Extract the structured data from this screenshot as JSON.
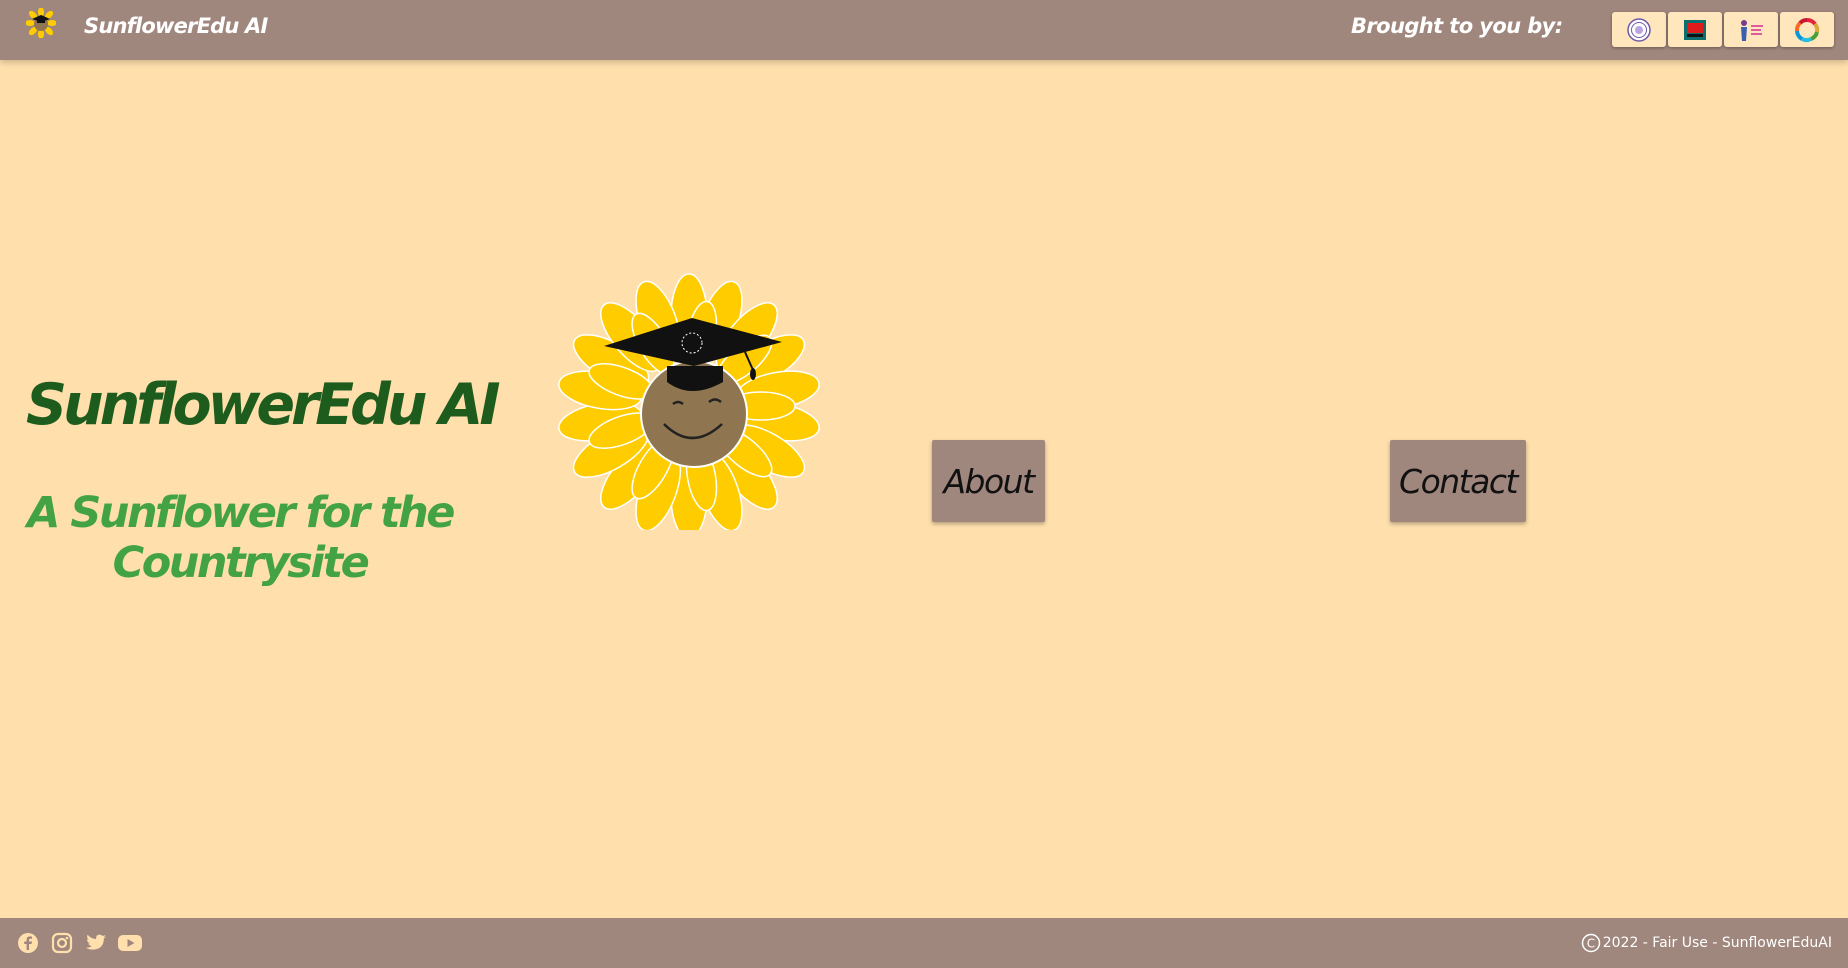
{
  "header": {
    "brand": "SunflowerEdu AI",
    "brought_by": "Brought to you by:",
    "sponsors": [
      {
        "icon": "university-seal-icon"
      },
      {
        "icon": "screen-logo-icon"
      },
      {
        "icon": "women-figure-logo-icon"
      },
      {
        "icon": "sdg-wheel-icon"
      }
    ]
  },
  "hero": {
    "title": "SunflowerEdu AI",
    "subtitle": "A Sunflower for the Countrysite"
  },
  "nav": {
    "about": "About",
    "contact": "Contact"
  },
  "footer": {
    "social": [
      "facebook-icon",
      "instagram-icon",
      "twitter-icon",
      "youtube-icon"
    ],
    "copyright_symbol": "C",
    "copyright": "2022 - Fair Use - SunflowerEduAI"
  },
  "colors": {
    "background": "#ffe0ad",
    "bar": "#a0877e",
    "title": "#1e5c1e",
    "subtitle": "#43a343",
    "petal": "#ffcc00",
    "face": "#8f7650"
  }
}
